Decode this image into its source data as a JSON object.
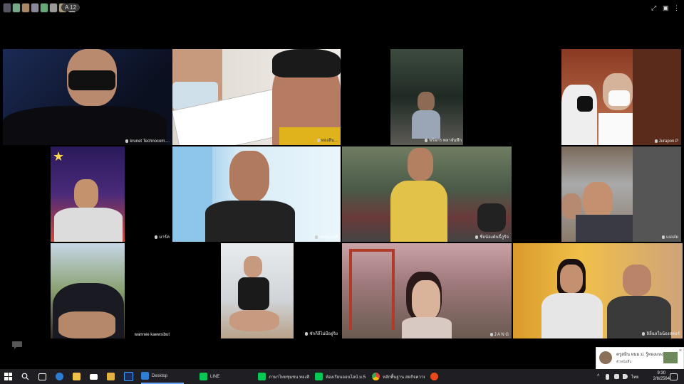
{
  "meeting": {
    "participant_count": "A 12",
    "participants": [
      {
        "name": "krunet Technocom...."
      },
      {
        "name": "ทองสิน..."
      },
      {
        "name": "ชรัตกร พลาจันทึก"
      },
      {
        "name": "Jurapon.P"
      },
      {
        "name": "มาร์ค"
      },
      {
        "name": "เดชณรงค์"
      },
      {
        "name": "ชื่อน้องต้นธิ์ภูริจ"
      },
      {
        "name": "แม่เอ๋ย"
      },
      {
        "name": "wannee kaewsibut"
      },
      {
        "name": "ซักกีลีไม่มีอยู่จิง"
      },
      {
        "name": "J A N G"
      },
      {
        "name": "ลิลี่ฉลใอน้องสตอร์"
      }
    ]
  },
  "notification": {
    "title": "ครูสมิน หมม.ป. รู้ทองแหงาง...",
    "subtitle": "ตัวหนังสืบ"
  },
  "taskbar": {
    "search_label": "",
    "desktop_label": "Desktop",
    "line_label": "LINE",
    "app1_label": "ภาษาไทยชุมชน ทองสิน...",
    "app2_label": "ห้องเรียนออนไลน์ ม.5-6",
    "app3_label": "หลักพื้นฐาน สหกิจความ...",
    "time": "9:30",
    "date": "2/8/2564",
    "lang": "ไทย"
  },
  "colors": {
    "background": "#000000",
    "taskbar": "#1f1f23",
    "line_green": "#06c755",
    "chrome_blue": "#1a73e8"
  }
}
